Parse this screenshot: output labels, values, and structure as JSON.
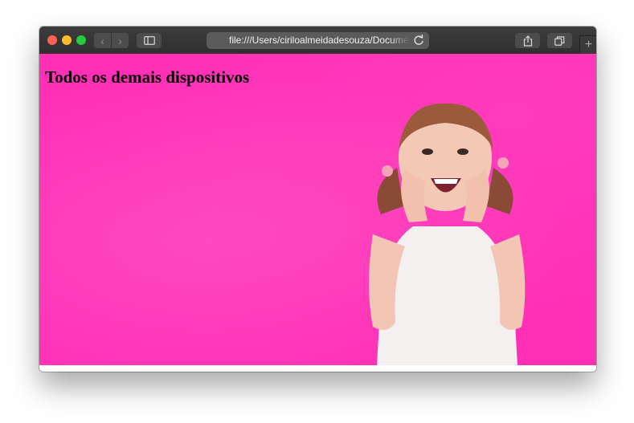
{
  "browser": {
    "url": "file:///Users/ciriloalmeidadesouza/Documents/index.html",
    "nav_back": "‹",
    "nav_forward": "›",
    "new_tab": "+"
  },
  "page": {
    "heading": "Todos os demais dispositivos"
  },
  "icons": {
    "sidebar": "sidebar-icon",
    "share": "share-icon",
    "tabs": "tabs-overview-icon",
    "reload": "reload-icon"
  },
  "colors": {
    "page_background": "#ff2fb6",
    "titlebar": "#353535",
    "close": "#fe5f57",
    "minimize": "#febc2e",
    "zoom": "#28c840"
  }
}
